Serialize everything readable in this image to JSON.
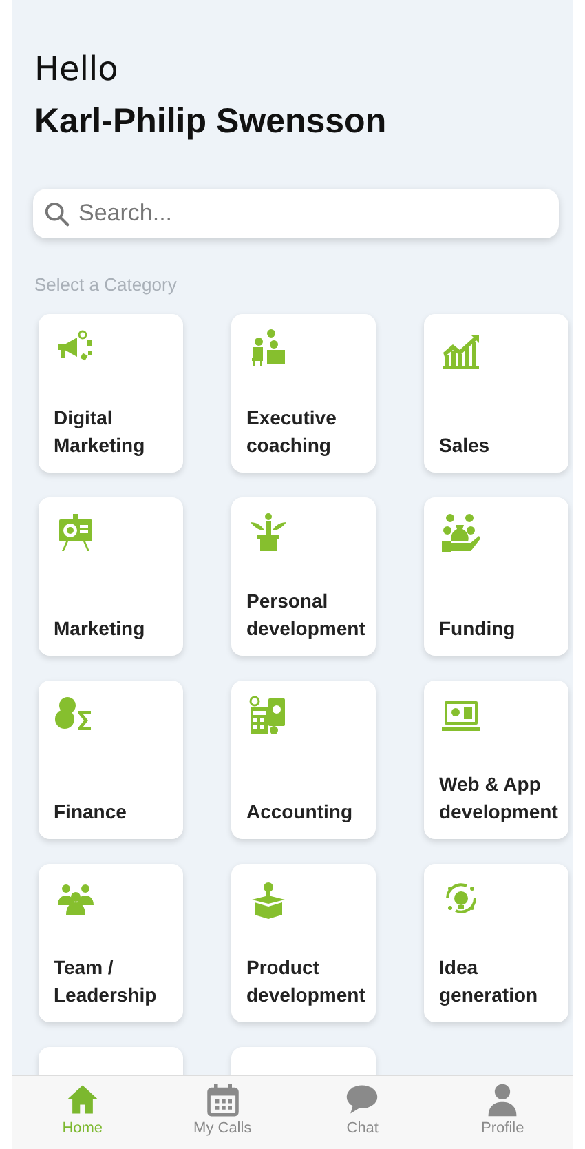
{
  "greeting": {
    "hello": "Hello",
    "name": "Karl-Philip Swensson"
  },
  "search": {
    "placeholder": "Search..."
  },
  "section_title": "Select a Category",
  "categories": [
    {
      "kind": "category",
      "label": "Digital Marketing"
    },
    {
      "kind": "category",
      "label": "Executive coaching"
    },
    {
      "kind": "category",
      "label": "Sales"
    },
    {
      "kind": "category",
      "label": "Marketing"
    },
    {
      "kind": "category",
      "label": "Personal development"
    },
    {
      "kind": "category",
      "label": "Funding"
    },
    {
      "kind": "category",
      "label": "Finance"
    },
    {
      "kind": "category",
      "label": "Accounting"
    },
    {
      "kind": "category",
      "label": "Web & App development"
    },
    {
      "kind": "category",
      "label": "Team / Leadership"
    },
    {
      "kind": "category",
      "label": "Product development"
    },
    {
      "kind": "category",
      "label": "Idea generation"
    },
    {
      "kind": "partial"
    },
    {
      "kind": "partial"
    }
  ],
  "tab_bar": [
    {
      "label": "Home",
      "selected": true
    },
    {
      "label": "My Calls",
      "selected": false
    },
    {
      "label": "Chat",
      "selected": false
    },
    {
      "label": "Profile",
      "selected": false
    }
  ]
}
